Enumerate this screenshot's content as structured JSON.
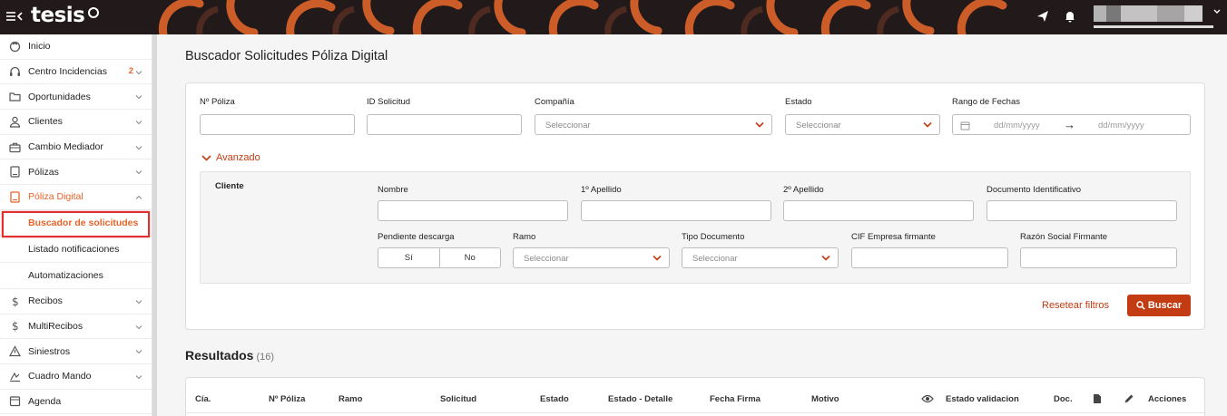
{
  "topbar": {
    "logo": "tesis",
    "menu_icon": "hamburger-collapse-icon",
    "icons": [
      "send-icon",
      "bell-icon",
      "user-avatar",
      "chevron-down-icon"
    ]
  },
  "sidebar": {
    "items": [
      {
        "label": "Inicio",
        "icon": "circle-icon"
      },
      {
        "label": "Centro Incidencias",
        "icon": "headset-icon",
        "badge": "2"
      },
      {
        "label": "Oportunidades",
        "icon": "folder-icon"
      },
      {
        "label": "Clientes",
        "icon": "user-icon"
      },
      {
        "label": "Cambio Mediador",
        "icon": "briefcase-icon"
      },
      {
        "label": "Pólizas",
        "icon": "document-icon"
      },
      {
        "label": "Póliza Digital",
        "icon": "tablet-icon"
      }
    ],
    "sub_items": [
      {
        "label": "Buscador de solicitudes"
      },
      {
        "label": "Listado notificaciones"
      },
      {
        "label": "Automatizaciones"
      }
    ],
    "items_after": [
      {
        "label": "Recibos",
        "icon": "dollar-icon"
      },
      {
        "label": "MultiRecibos",
        "icon": "dollar-icon"
      },
      {
        "label": "Siniestros",
        "icon": "warning-icon"
      },
      {
        "label": "Cuadro Mando",
        "icon": "gauge-icon"
      },
      {
        "label": "Agenda",
        "icon": "calendar-icon"
      }
    ]
  },
  "main": {
    "title": "Buscador Solicitudes Póliza Digital",
    "filters": {
      "poliza_label": "Nº Póliza",
      "id_label": "ID Solicitud",
      "compania_label": "Compañía",
      "compania_placeholder": "Seleccionar",
      "estado_label": "Estado",
      "estado_placeholder": "Seleccionar",
      "rango_label": "Rango de Fechas",
      "date_from_placeholder": "dd/mm/yyyy",
      "date_to_placeholder": "dd/mm/yyyy",
      "date_arrow": "→"
    },
    "advanced": {
      "toggle_label": "Avanzado",
      "section_label": "Cliente",
      "nombre_label": "Nombre",
      "apellido1_label": "1º Apellido",
      "apellido2_label": "2º Apellido",
      "documento_label": "Documento Identificativo",
      "pendiente_label": "Pendiente descarga",
      "pendiente_options": [
        "Sí",
        "No"
      ],
      "ramo_label": "Ramo",
      "ramo_placeholder": "Seleccionar",
      "tipo_doc_label": "Tipo Documento",
      "tipo_doc_placeholder": "Seleccionar",
      "cif_label": "CIF Empresa firmante",
      "razon_label": "Razón Social Firmante"
    },
    "actions": {
      "reset_label": "Resetear filtros",
      "search_label": "Buscar"
    },
    "results": {
      "title": "Resultados",
      "count": "(16)",
      "columns": [
        "Cía.",
        "Nº Póliza",
        "Ramo",
        "Solicitud",
        "Estado",
        "Estado - Detalle",
        "Fecha Firma",
        "Motivo",
        "Estado validacion",
        "Doc.",
        "Acciones"
      ]
    }
  },
  "colors": {
    "accent": "#c23b12",
    "accent_light": "#e8632a",
    "topbar": "#221a1a"
  }
}
